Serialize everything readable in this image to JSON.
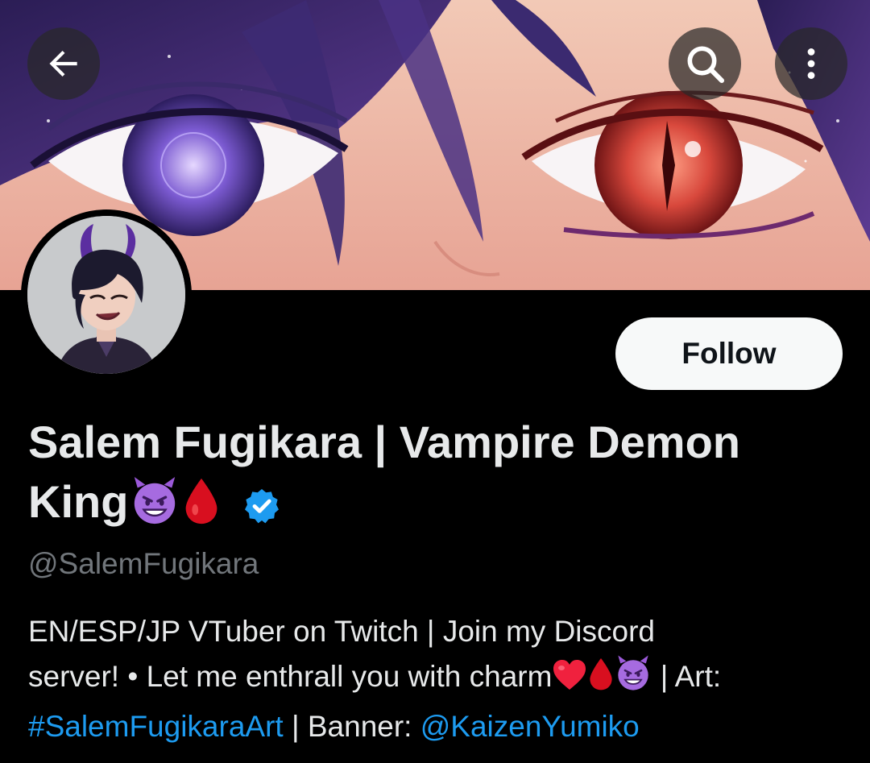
{
  "header": {
    "back_icon": "arrow-left-icon",
    "search_icon": "search-icon",
    "more_icon": "more-vertical-icon"
  },
  "profile": {
    "display_name_text": "Salem Fugikara | Vampire Demon King",
    "display_name_emojis": [
      "smiling-devil-emoji",
      "blood-drop-emoji"
    ],
    "verified_icon": "verified-badge-icon",
    "handle": "@SalemFugikara",
    "follow_label": "Follow"
  },
  "bio": {
    "line1": "EN/ESP/JP VTuber on Twitch | Join my Discord",
    "line2_text": "server! • Let me enthrall you with charm",
    "line2_emojis": [
      "red-heart-emoji",
      "blood-drop-emoji",
      "smiling-devil-emoji"
    ],
    "line2_suffix": " | Art:",
    "hashtag": "#SalemFugikaraArt",
    "banner_label": " | Banner: ",
    "banner_mention": "@KaizenYumiko"
  },
  "colors": {
    "background": "#000000",
    "text": "#e7e9ea",
    "muted": "#71767b",
    "link": "#1d9bf0",
    "follow_bg": "#f7f9f9",
    "verified": "#1d9bf0"
  }
}
